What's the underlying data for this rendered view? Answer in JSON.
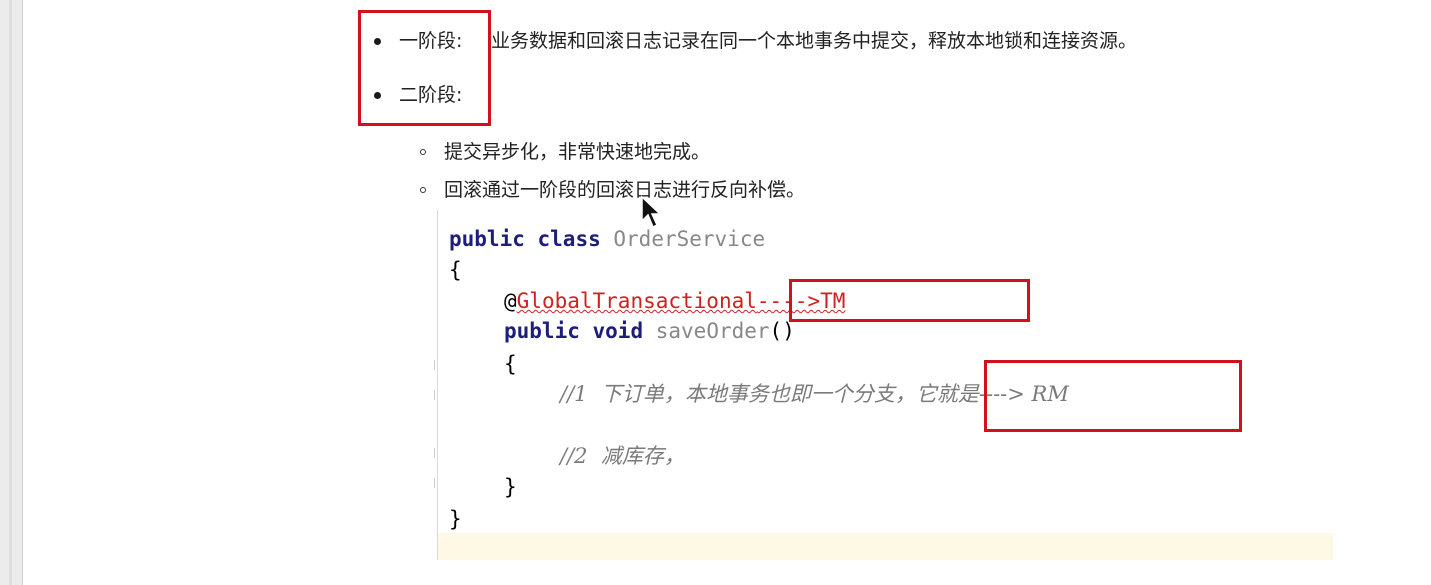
{
  "bullets": {
    "phase1_label": "一阶段:",
    "phase1_text": "业务数据和回滚日志记录在同一个本地事务中提交，释放本地锁和连接资源。",
    "phase2_label": "二阶段:"
  },
  "sub_bullets": {
    "item1": "提交异步化，非常快速地完成。",
    "item2": "回滚通过一阶段的回滚日志进行反向补偿。"
  },
  "code": {
    "kw_public": "public",
    "kw_class": "class",
    "class_name": "OrderService",
    "brace_open": "{",
    "brace_close": "}",
    "at_sign": "@",
    "annotation": "GlobalTransactional",
    "annotation_note": "---->TM",
    "kw_void": "void",
    "method_name": "saveOrder",
    "parens": "()",
    "comment1": "//1  下订单，本地事务也即一个分支，",
    "comment1_note": "它就是----> RM",
    "comment2": "//2  减库存，"
  },
  "colors": {
    "highlight_box": "#d1111c",
    "keyword": "#1d1d7a",
    "annotation": "#d02020",
    "comment": "#7a7a7a"
  },
  "icons": [
    "mouse-cursor-icon"
  ]
}
